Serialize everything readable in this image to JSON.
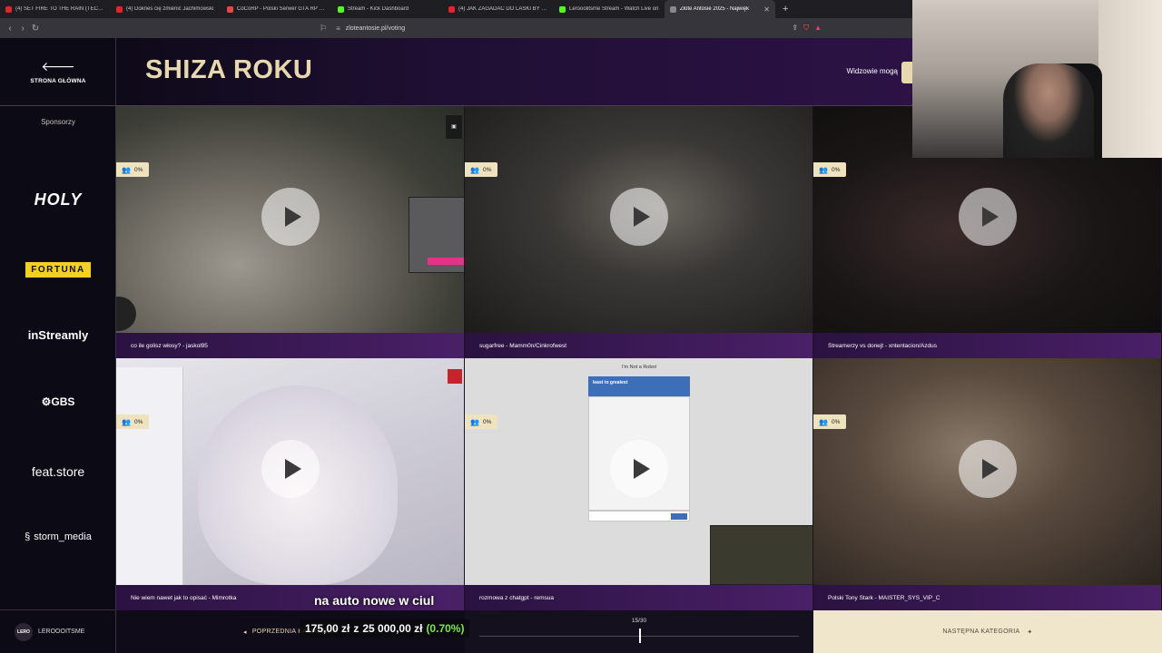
{
  "browser": {
    "tabs": [
      {
        "title": "(4) SET FIRE TO THE RAIN (TECHNO)",
        "color": "#e8222a"
      },
      {
        "title": "(4) Doknes cię zmienić Jachimowski",
        "color": "#e8222a"
      },
      {
        "title": "CoCoRP - Polski Serwer GTA RP White",
        "color": "#e44"
      },
      {
        "title": "Stream - Kick Dashboard",
        "color": "#53fc18"
      },
      {
        "title": "(4) JAK ZAGADAĆ DO LASKI BY ZGR",
        "color": "#e8222a"
      },
      {
        "title": "Lerooolitsme Stream - Watch Live on",
        "color": "#53fc18"
      },
      {
        "title": "Złote Antosie 2025 - Najwięk",
        "color": "#888888"
      }
    ],
    "url": "zloteantosie.pl/voting"
  },
  "sidebar": {
    "home_label": "STRONA GŁÓWNA",
    "sponsors_title": "Sponsorzy",
    "sponsors": {
      "holy": "HOLY",
      "fortuna": "FORTUNA",
      "instreamly": "inStreamly",
      "gbs": "GBS",
      "feat": "feat.store",
      "storm": "storm_media"
    },
    "user": {
      "avatar": "LERO",
      "name": "LEROOOITSME"
    }
  },
  "header": {
    "title": "SHIZA ROKU",
    "viewers_label": "Widzowie mogą"
  },
  "cards": [
    {
      "percent": "0%",
      "caption": "co ile golisz włosy? - jaskol95"
    },
    {
      "percent": "0%",
      "caption": "sugarfree - Mamm0n/Cinkrofwest"
    },
    {
      "percent": "0%",
      "caption": "Streamerzy vs donejt - xntentacion/Azdus"
    },
    {
      "percent": "0%",
      "caption": "Nie wiem nawet jak to opisać - Mimrotka"
    },
    {
      "percent": "0%",
      "caption": "rozmowa z chatgpt - remsua"
    },
    {
      "percent": "0%",
      "caption": "Polski Tony Stark - MAISTER_SYS_VIP_C"
    }
  ],
  "captcha": {
    "title": "I'm Not a Robot",
    "head": "least to greatest"
  },
  "footer": {
    "prev_label": "POPRZEDNIA KATEGORIA",
    "progress": "15/30",
    "progress_fraction": 0.5,
    "next_label": "NASTĘPNA KATEGORIA"
  },
  "overlay": {
    "donation_amount": "175,00 zł",
    "donation_of": "z",
    "donation_goal": "25 000,00 zł",
    "donation_pct": "(0.70%)",
    "text": "na auto nowe w ciul"
  }
}
